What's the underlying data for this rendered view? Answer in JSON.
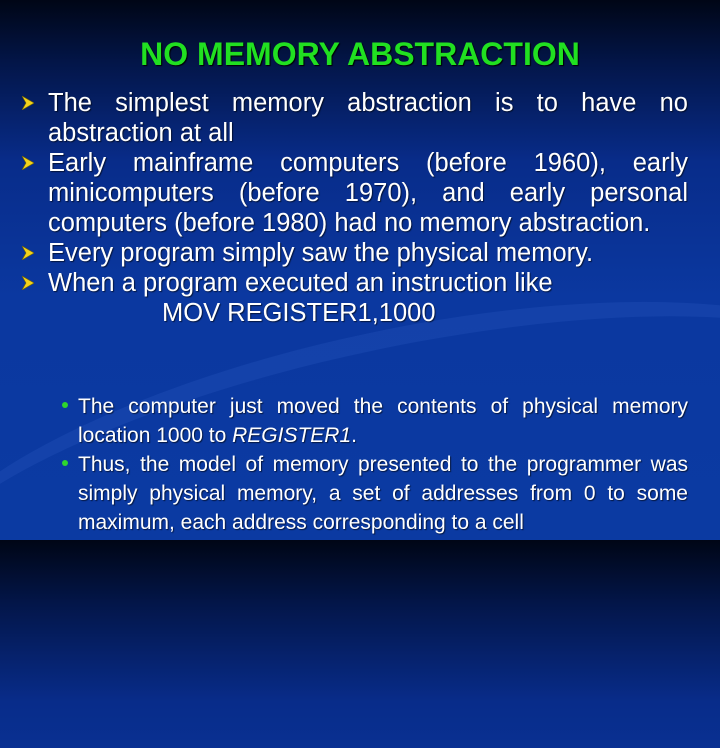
{
  "slide": {
    "title": "NO MEMORY ABSTRACTION",
    "accent_color": "#21e021",
    "bullet_icon": "yellow-arrowhead",
    "bullets": [
      {
        "text": "The simplest memory abstraction is to have no abstraction at all"
      },
      {
        "text": "Early mainframe computers (before 1960), early minicomputers (before 1970), and early personal computers (before 1980) had no memory abstraction."
      },
      {
        "text": "Every program simply saw the physical memory."
      },
      {
        "text": "When a program executed an instruction like"
      }
    ],
    "code_line": "MOV REGISTER1,1000",
    "sub_bullets": [
      {
        "text_before": "The computer just moved the contents of physical memory location 1000 to ",
        "italic": "REGISTER1",
        "text_after": "."
      },
      {
        "text": "Thus, the model of memory presented to the programmer was simply physical memory, a set of addresses from 0 to some maximum, each address corresponding to a cell"
      }
    ]
  }
}
